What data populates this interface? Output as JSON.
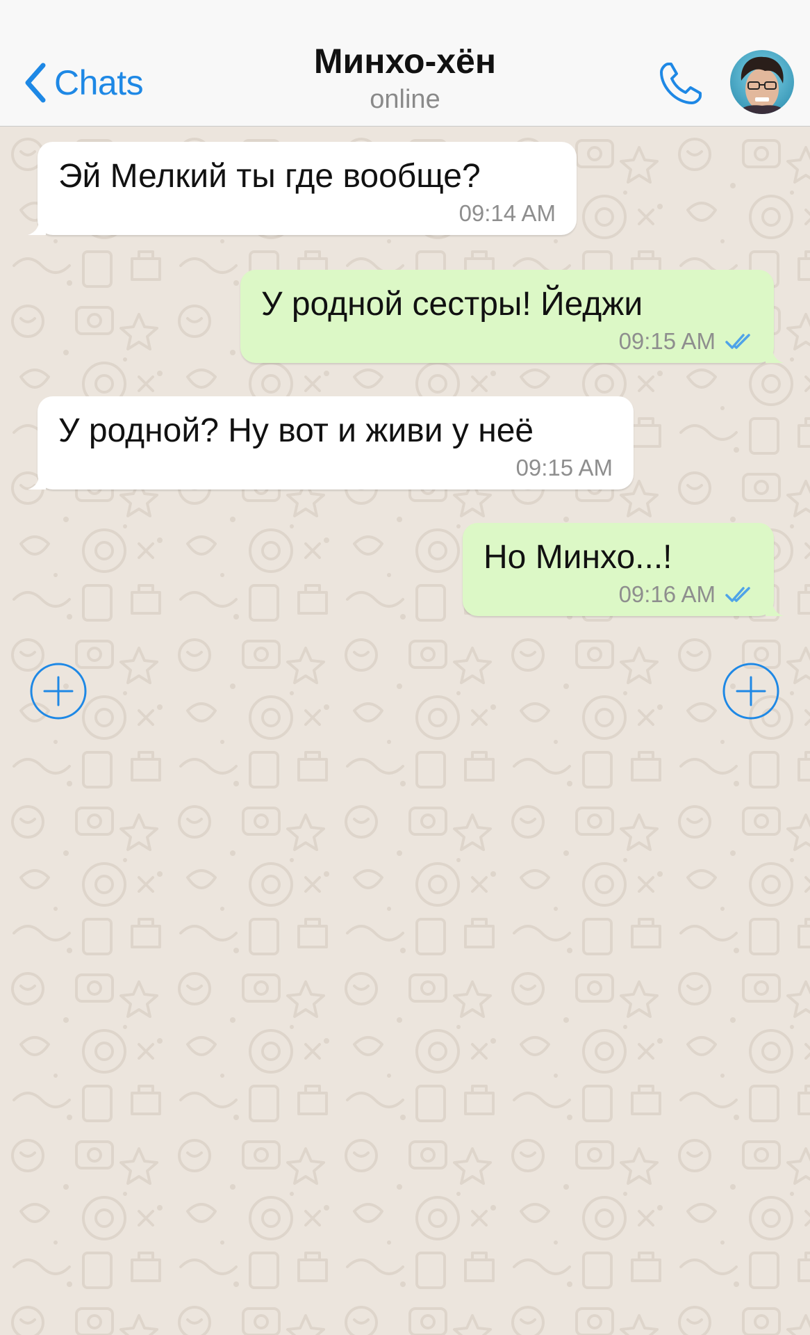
{
  "header": {
    "back_label": "Chats",
    "contact_name": "Минхо-хён",
    "status": "online",
    "call_icon": "phone-icon",
    "avatar_icon": "contact-avatar"
  },
  "messages": [
    {
      "direction": "incoming",
      "text": "Эй Мелкий ты где вообще?",
      "time": "09:14 AM"
    },
    {
      "direction": "outgoing",
      "text": "У родной сестры! Йеджи",
      "time": "09:15 AM",
      "status": "read"
    },
    {
      "direction": "incoming",
      "text": "У родной? Ну вот и живи у неё",
      "time": "09:15 AM"
    },
    {
      "direction": "outgoing",
      "text": "Но Минхо...!",
      "time": "09:16 AM",
      "status": "read"
    }
  ],
  "controls": {
    "left_add_icon": "plus-circle-icon",
    "right_add_icon": "plus-circle-icon"
  },
  "colors": {
    "accent": "#1E88E5",
    "header_bg": "#F8F8F8",
    "chat_bg": "#ECE5DD",
    "incoming_bubble": "#FFFFFF",
    "outgoing_bubble": "#DCF8C6",
    "read_ticks": "#4FA3E8",
    "time_text": "#8E8E8E"
  }
}
